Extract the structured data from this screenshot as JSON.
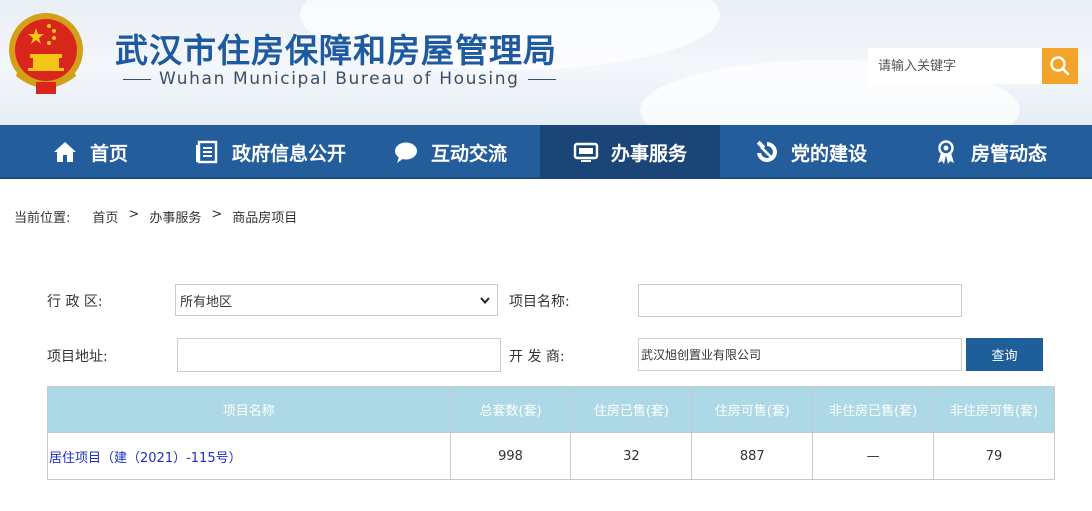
{
  "header": {
    "title": "武汉市住房保障和房屋管理局",
    "subtitle": "Wuhan Municipal Bureau of Housing",
    "search_placeholder": "请输入关键字"
  },
  "nav": {
    "items": [
      {
        "label": "首页",
        "icon": "home-icon"
      },
      {
        "label": "政府信息公开",
        "icon": "document-icon"
      },
      {
        "label": "互动交流",
        "icon": "chat-bubble-icon"
      },
      {
        "label": "办事服务",
        "icon": "monitor-icon",
        "active": true
      },
      {
        "label": "党的建设",
        "icon": "hammer-sickle-icon"
      },
      {
        "label": "房管动态",
        "icon": "award-ribbon-icon"
      }
    ]
  },
  "breadcrumb": {
    "label": "当前位置:",
    "items": [
      "首页",
      "办事服务",
      "商品房项目"
    ],
    "separator": ">"
  },
  "form": {
    "district_label": "行 政 区:",
    "district_value": "所有地区",
    "project_name_label": "项目名称:",
    "project_name_value": "",
    "address_label": "项目地址:",
    "address_value": "",
    "developer_label": "开 发 商:",
    "developer_value": "武汉旭创置业有限公司",
    "query_label": "查询"
  },
  "table": {
    "headers": [
      "项目名称",
      "总套数(套)",
      "住房已售(套)",
      "住房可售(套)",
      "非住房已售(套)",
      "非住房可售(套)"
    ],
    "rows": [
      [
        "居住项目（建（2021）-115号）",
        "998",
        "32",
        "887",
        "—",
        "79"
      ]
    ]
  },
  "colors": {
    "nav_bg": "#245d9b",
    "nav_active": "#1b4577",
    "title_blue": "#1e5aa0",
    "search_button": "#f3a52a",
    "query_button": "#1f5f99",
    "table_header": "#add8e6",
    "link": "#1d2fc4"
  }
}
